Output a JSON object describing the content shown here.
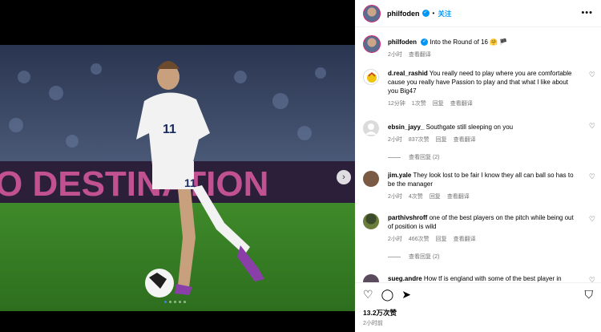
{
  "post": {
    "username": "philfoden",
    "follow_label": "关注",
    "caption_user": "philfoden",
    "caption_text": "Into the Round of 16",
    "caption_emoji": "🤗 🏴",
    "caption_time": "2小时",
    "translate_label": "查看翻译",
    "stadium_text": "O DESTINATION",
    "jersey_number": "11"
  },
  "comments": [
    {
      "user": "d.real_rashid",
      "text": "You really need to play where you are comfortable cause you really have Passion to play and that what I like about you Big47",
      "time": "12分钟",
      "likes": "1次赞",
      "reply": "回复",
      "translate": "查看翻译"
    },
    {
      "user": "ebsin_jayy_",
      "text": "Southgate still sleeping on you",
      "time": "2小时",
      "likes": "837次赞",
      "reply": "回复",
      "translate": "查看翻译",
      "view_replies": "查看回复 (2)"
    },
    {
      "user": "jim.yale",
      "text": "They look lost to be fair I know they all can ball so has to be the manager",
      "time": "2小时",
      "likes": "4次赞",
      "reply": "回复",
      "translate": "查看翻译"
    },
    {
      "user": "parthivshroff",
      "text": "one of the best players on the pitch while being out of position is wild",
      "time": "2小时",
      "likes": "466次赞",
      "reply": "回复",
      "translate": "查看翻译",
      "view_replies": "查看回复 (2)"
    },
    {
      "user": "sueg.andre",
      "text": "How tf is england with some of the best player in"
    }
  ],
  "actions": {
    "like_count": "13.2万次赞",
    "time": "2小时前"
  },
  "colors": {
    "accent": "#0095f6",
    "muted": "#737373"
  }
}
